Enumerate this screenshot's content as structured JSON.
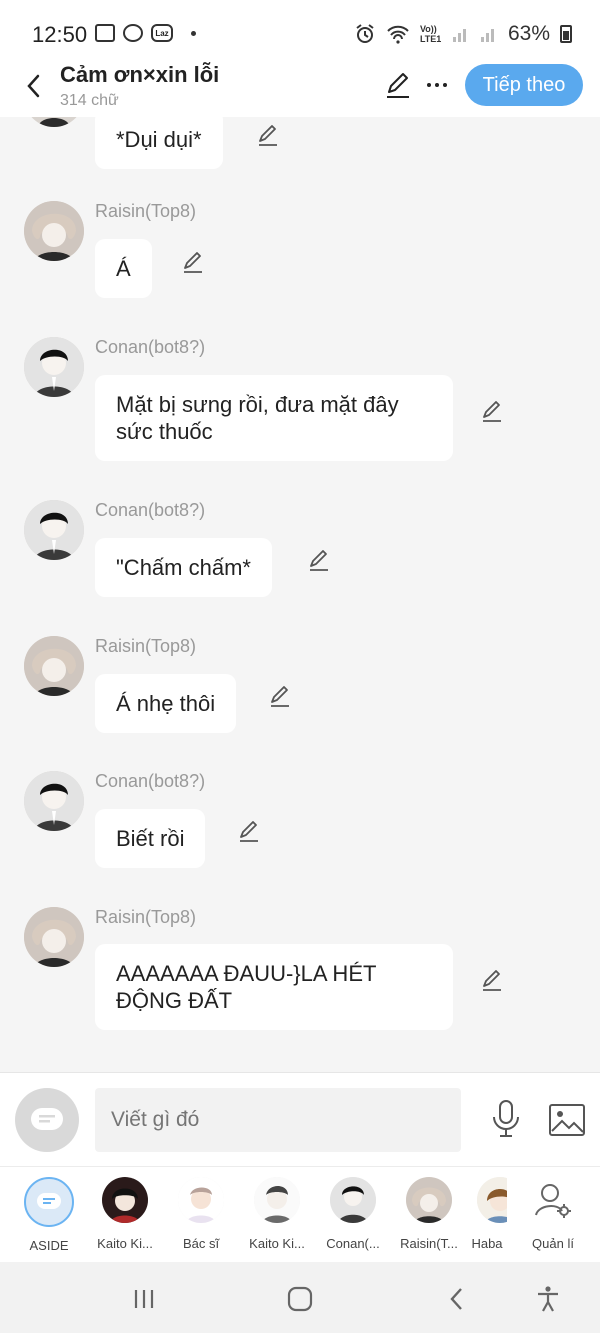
{
  "status_bar": {
    "time": "12:50",
    "network": "Vo)) LTE1",
    "battery": "63%"
  },
  "header": {
    "title": "Cảm ơn×xin lỗi",
    "subtitle": "314 chữ",
    "next_label": "Tiếp theo"
  },
  "messages": [
    {
      "sender": "",
      "text": "*Dụi dụi*"
    },
    {
      "sender": "Raisin(Top8)",
      "text": "Á"
    },
    {
      "sender": "Conan(bot8?)",
      "text": "Mặt bị sưng rồi, đưa mặt đây\nsức thuốc"
    },
    {
      "sender": "Conan(bot8?)",
      "text": "\"Chấm chấm*"
    },
    {
      "sender": "Raisin(Top8)",
      "text": "Á nhẹ thôi"
    },
    {
      "sender": "Conan(bot8?)",
      "text": "Biết rồi"
    },
    {
      "sender": "Raisin(Top8)",
      "text": "AAAAAAA ĐAUU-}LA HÉT\nĐỘNG ĐẤT"
    }
  ],
  "composer": {
    "placeholder": "Viết gì đó"
  },
  "characters": [
    {
      "name": "ASIDE"
    },
    {
      "name": "Kaito Ki..."
    },
    {
      "name": "Bác sĩ"
    },
    {
      "name": "Kaito Ki..."
    },
    {
      "name": "Conan(..."
    },
    {
      "name": "Raisin(T..."
    },
    {
      "name": "Haba"
    },
    {
      "name": "Quản lí"
    }
  ],
  "colors": {
    "accent": "#5aa9ee",
    "background": "#f5f5f5",
    "bubble": "#ffffff",
    "sender": "#999999"
  }
}
